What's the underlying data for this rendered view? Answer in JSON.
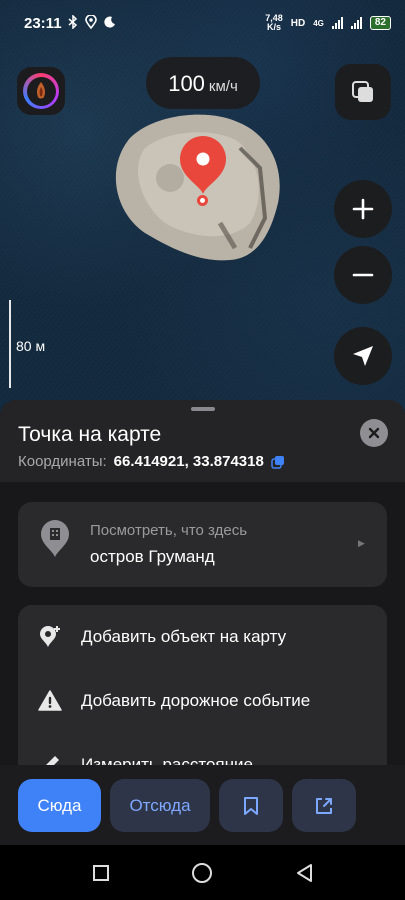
{
  "status_bar": {
    "time": "23:11",
    "net_speed_value": "7,48",
    "net_speed_unit": "K/s",
    "hd": "HD",
    "network": "4G",
    "battery": "82"
  },
  "map": {
    "speed_value": "100",
    "speed_unit": "км/ч",
    "scale_label": "80 м",
    "icons": [
      "avatar-icon",
      "layers-icon",
      "plus-icon",
      "minus-icon",
      "locate-arrow-icon",
      "map-pin-icon"
    ]
  },
  "place_sheet": {
    "title": "Точка на карте",
    "coords_label": "Координаты:",
    "coords_value": "66.414921, 33.874318",
    "whats_here_caption": "Посмотреть, что здесь",
    "whats_here_name": "остров Груманд",
    "actions": [
      {
        "label": "Добавить объект на карту",
        "icon": "add-place-icon"
      },
      {
        "label": "Добавить дорожное событие",
        "icon": "warning-icon"
      },
      {
        "label": "Измерить расстояние",
        "icon": "ruler-icon"
      }
    ]
  },
  "bottom_bar": {
    "route_here": "Сюда",
    "route_from": "Отсюда",
    "bookmark_icon": "bookmark-icon",
    "share_icon": "share-icon"
  },
  "colors": {
    "accent": "#3f82f7",
    "pin": "#e9473c",
    "sheet_bg": "#242426",
    "card_bg": "#2a2a2c"
  }
}
